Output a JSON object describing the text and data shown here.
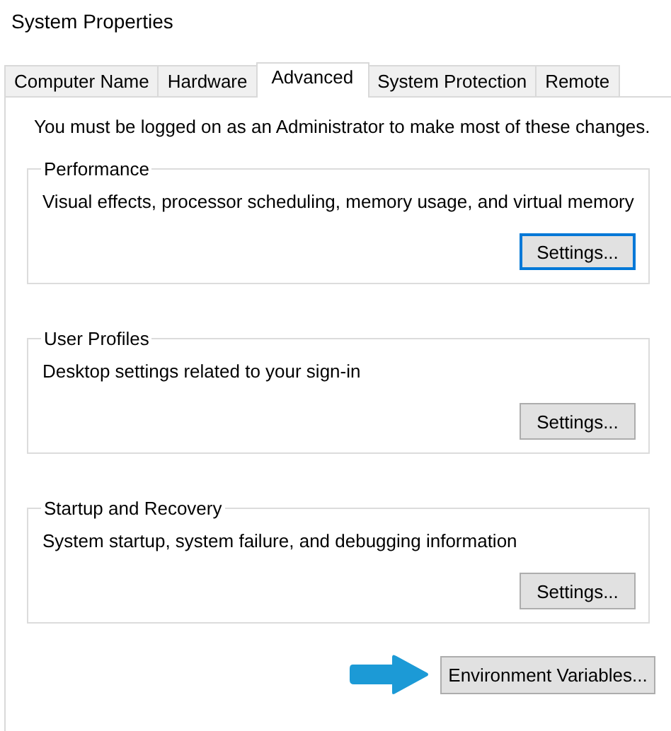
{
  "window": {
    "title": "System Properties"
  },
  "tabs": [
    {
      "label": "Computer Name",
      "selected": false
    },
    {
      "label": "Hardware",
      "selected": false
    },
    {
      "label": "Advanced",
      "selected": true
    },
    {
      "label": "System Protection",
      "selected": false
    },
    {
      "label": "Remote",
      "selected": false
    }
  ],
  "notice": "You must be logged on as an Administrator to make most of these changes.",
  "groups": [
    {
      "title": "Performance",
      "description": "Visual effects, processor scheduling, memory usage, and virtual memory",
      "button": {
        "label": "Settings...",
        "focused": true
      }
    },
    {
      "title": "User Profiles",
      "description": "Desktop settings related to your sign-in",
      "button": {
        "label": "Settings...",
        "focused": false
      }
    },
    {
      "title": "Startup and Recovery",
      "description": "System startup, system failure, and debugging information",
      "button": {
        "label": "Settings...",
        "focused": false
      }
    }
  ],
  "footer_button": {
    "label": "Environment Variables...",
    "focused": false
  }
}
